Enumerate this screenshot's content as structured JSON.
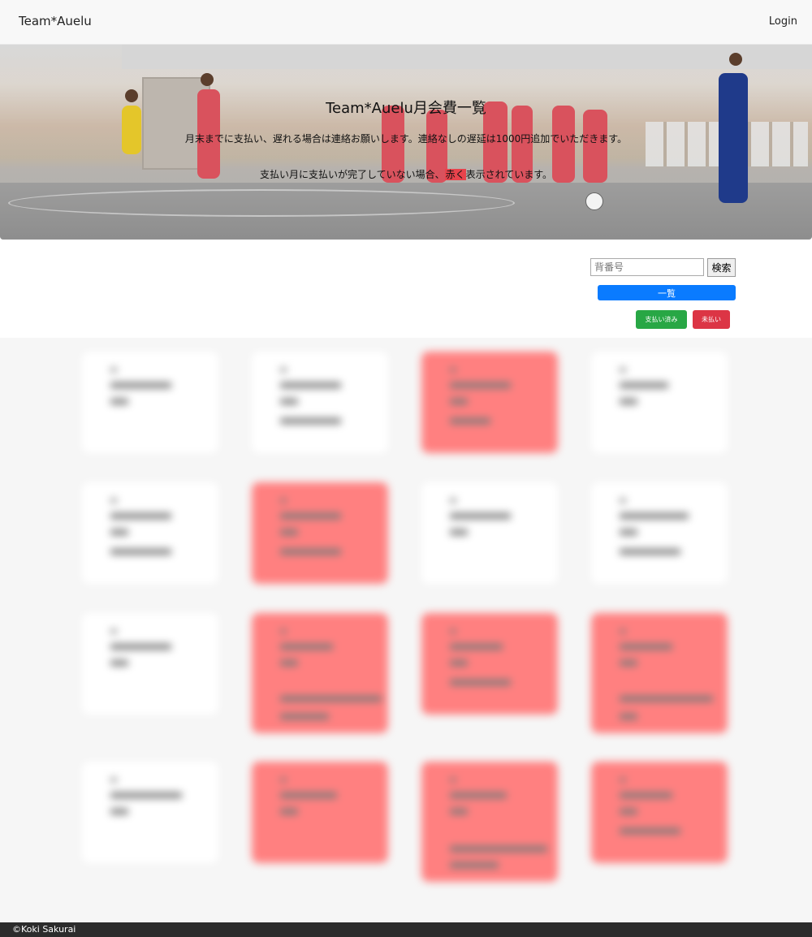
{
  "navbar": {
    "brand": "Team*Auelu",
    "login": "Login"
  },
  "hero": {
    "title": "Team*Auelu月会費一覧",
    "line1": "月末までに支払い、遅れる場合は連絡お願いします。連絡なしの遅延は1000円追加でいただきます。",
    "line2_before": "支払い月に支払いが完了していない場合、",
    "line2_mark": "赤く",
    "line2_after": "表示されています。"
  },
  "search": {
    "placeholder": "背番号",
    "button": "検索"
  },
  "controls": {
    "list_label": "一覧",
    "paid_label": "支払い済み",
    "unpaid_label": "未払い"
  },
  "colors": {
    "unpaid_card": "#ff8080",
    "paid_card": "#ffffff",
    "accent": "#0a7bff",
    "paid": "#28a745",
    "unpaid": "#dc3545"
  },
  "cards": [
    {
      "status": "paid"
    },
    {
      "status": "paid"
    },
    {
      "status": "unpaid"
    },
    {
      "status": "paid"
    },
    {
      "status": "paid"
    },
    {
      "status": "unpaid"
    },
    {
      "status": "paid"
    },
    {
      "status": "paid"
    },
    {
      "status": "paid"
    },
    {
      "status": "unpaid"
    },
    {
      "status": "unpaid"
    },
    {
      "status": "unpaid"
    },
    {
      "status": "paid"
    },
    {
      "status": "unpaid"
    },
    {
      "status": "unpaid"
    },
    {
      "status": "unpaid"
    }
  ],
  "footer": {
    "copyright": "©Koki Sakurai"
  }
}
